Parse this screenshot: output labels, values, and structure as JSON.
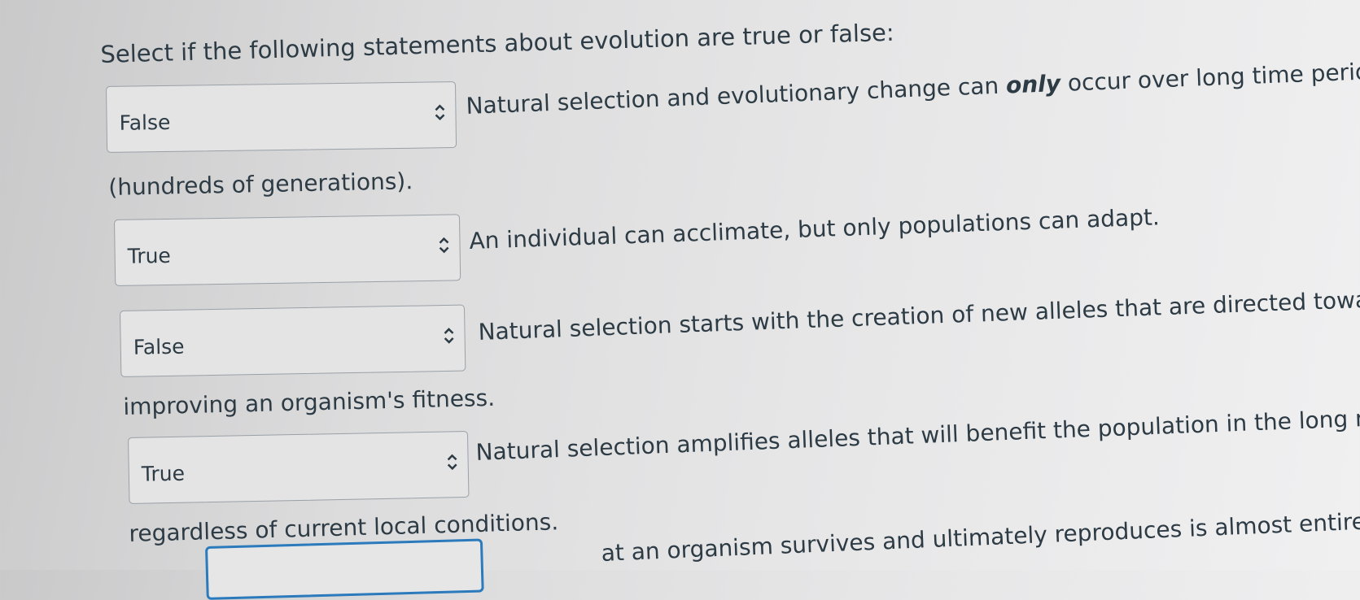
{
  "prompt": "Select if the following statements about evolution are true or false:",
  "questions": [
    {
      "selected": "False",
      "statement_pre": "Natural selection and evolutionary change can ",
      "statement_emph": "only",
      "statement_post": " occur over long time periods",
      "continuation": "(hundreds of generations)."
    },
    {
      "selected": "True",
      "statement": "An individual can acclimate, but only populations can adapt."
    },
    {
      "selected": "False",
      "statement": "Natural selection starts with the creation of new alleles that are directed toward",
      "continuation": "improving an organism's fitness."
    },
    {
      "selected": "True",
      "statement": "Natural selection amplifies alleles that will benefit the population in the long run,",
      "continuation": "regardless of current local conditions."
    },
    {
      "selected": "",
      "statement": "at an organism survives and ultimately reproduces is almost entirely a matter"
    }
  ],
  "icons": {
    "select_arrow": "chevron-up-down-icon"
  },
  "colors": {
    "focus_border": "#2b7abc",
    "text": "#2d3b45"
  }
}
